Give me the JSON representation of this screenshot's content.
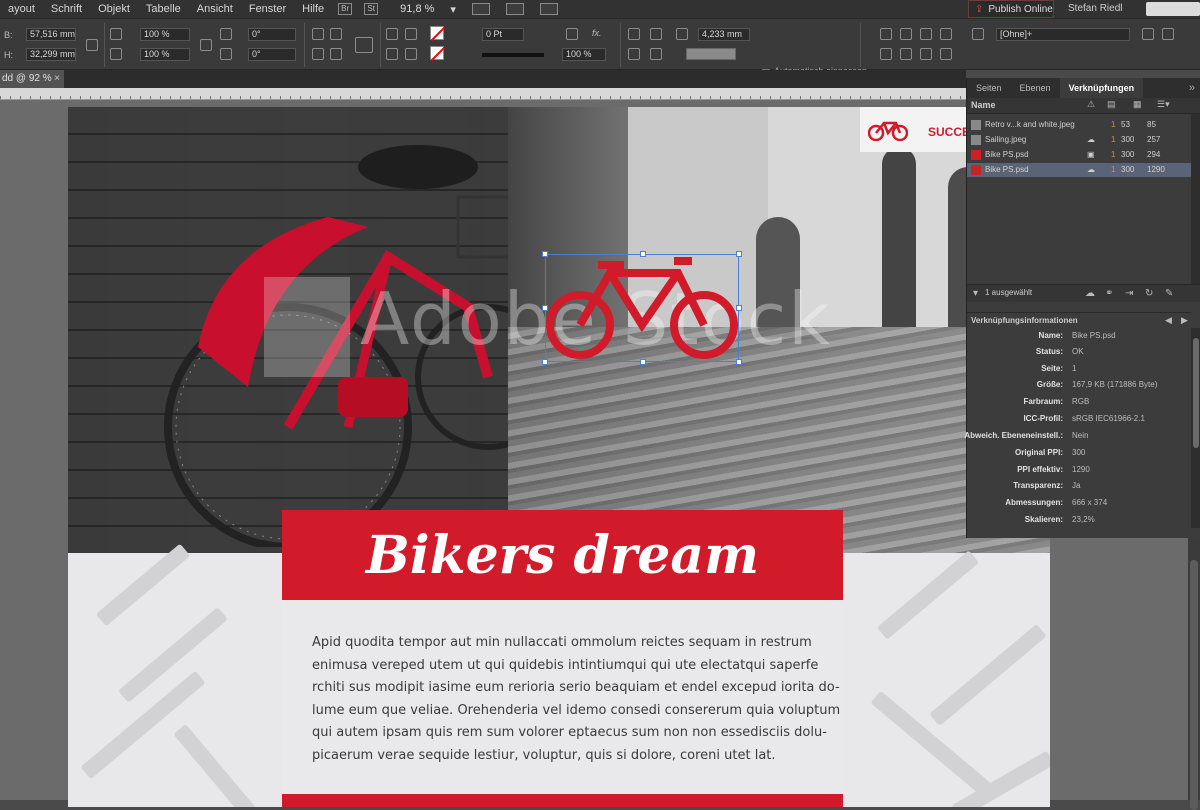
{
  "menu": {
    "items": [
      "ayout",
      "Schrift",
      "Objekt",
      "Tabelle",
      "Ansicht",
      "Fenster",
      "Hilfe"
    ],
    "badge_br": "Br",
    "badge_st": "St",
    "zoom": "91,8 %",
    "publish": "Publish Online",
    "user": "Stefan Riedl"
  },
  "control": {
    "b_label": "B:",
    "b_value": "57,516 mm",
    "h_label": "H:",
    "h_value": "32,299 mm",
    "scale_x": "100 %",
    "scale_y": "100 %",
    "rotate": "0°",
    "shear": "0°",
    "stroke_weight": "0 Pt",
    "opacity": "100 %",
    "spacing": "4,233 mm",
    "autofit": "Automatisch einpassen",
    "object_style": "[Ohne]+"
  },
  "document": {
    "tab": "dd @ 92 %",
    "close": "×"
  },
  "layout": {
    "headline": "Bikers dream",
    "brand_text": "SUCCE",
    "watermark": "Adobe Stock",
    "body_lines": [
      "Apid quodita tempor aut min nullaccati ommolum reictes sequam in restrum",
      "enimusa vereped utem ut qui quidebis intintiumqui qui ute electatqui saperfe",
      "rchiti sus modipit iasime eum rerioria serio beaquiam et endel excepud iorita do-",
      "lume eum que veliae. Orehenderia vel idemo consedi consererum quia voluptum",
      "qui autem ipsam quis rem sum volorer eptaecus sum non non essedisciis dolu-",
      "picaerum verae sequide lestiur, voluptur, quis si dolore, coreni utet lat."
    ]
  },
  "panel": {
    "tabs": [
      "Seiten",
      "Ebenen",
      "Verknüpfungen"
    ],
    "active_tab": "Verknüpfungen",
    "column_name": "Name",
    "links": [
      {
        "name": "Retro v...k and white.jpeg",
        "page": "1",
        "ppi": "53",
        "eff": "85",
        "selected": false
      },
      {
        "name": "Sailing.jpeg",
        "page": "1",
        "ppi": "300",
        "eff": "257",
        "selected": false
      },
      {
        "name": "Bike PS.psd",
        "page": "1",
        "ppi": "300",
        "eff": "294",
        "selected": false
      },
      {
        "name": "Bike PS.psd",
        "page": "1",
        "ppi": "300",
        "eff": "1290",
        "selected": true
      }
    ],
    "selected_count": "1 ausgewählt",
    "info_title": "Verknüpfungsinformationen",
    "info": [
      {
        "k": "Name:",
        "v": "Bike PS.psd"
      },
      {
        "k": "Status:",
        "v": "OK"
      },
      {
        "k": "Seite:",
        "v": "1"
      },
      {
        "k": "Größe:",
        "v": "167,9 KB (171886 Byte)"
      },
      {
        "k": "Farbraum:",
        "v": "RGB"
      },
      {
        "k": "ICC-Profil:",
        "v": "sRGB IEC61966-2.1"
      },
      {
        "k": "Abweich. Ebeneneinstell.:",
        "v": "Nein"
      },
      {
        "k": "Original PPI:",
        "v": "300"
      },
      {
        "k": "PPI effektiv:",
        "v": "1290"
      },
      {
        "k": "Transparenz:",
        "v": "Ja"
      },
      {
        "k": "Abmessungen:",
        "v": "666 x 374"
      },
      {
        "k": "Skalieren:",
        "v": "23,2%"
      }
    ]
  },
  "colors": {
    "accent_red": "#d11a2a",
    "selection_blue": "#4a7fd6",
    "ui_dark": "#3a3a3a"
  }
}
